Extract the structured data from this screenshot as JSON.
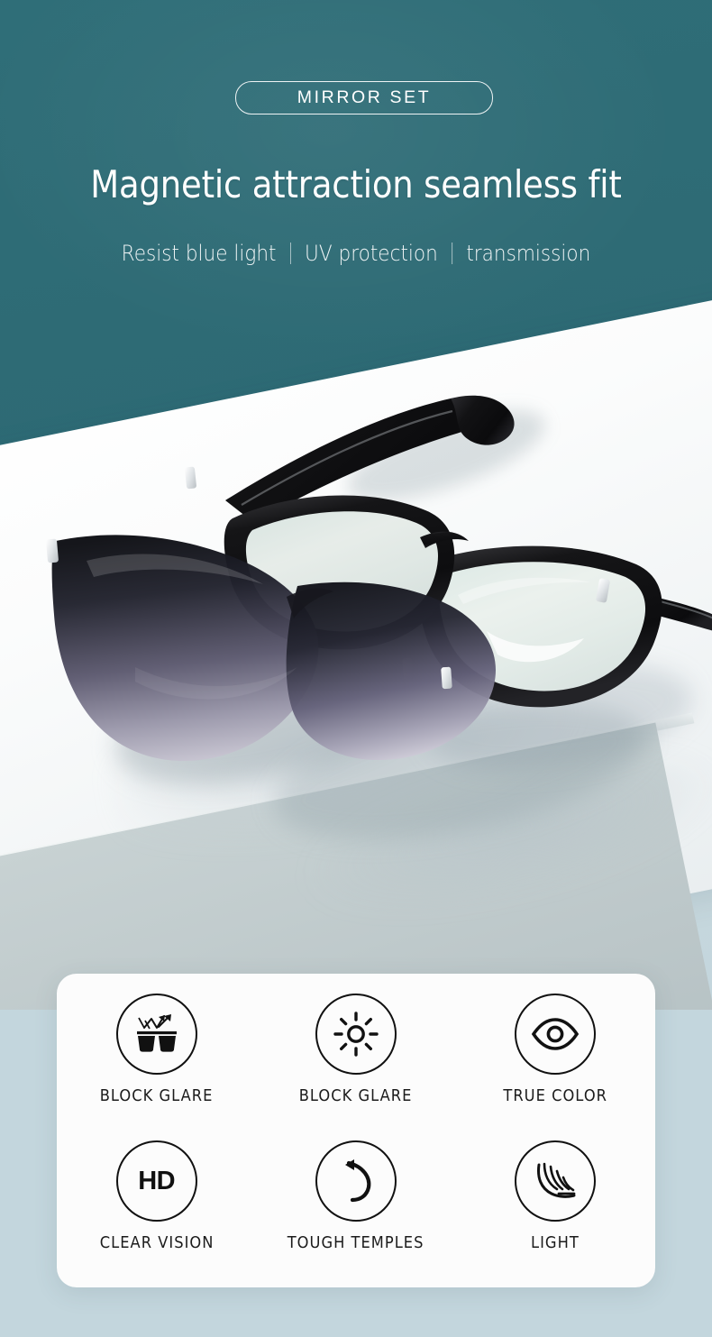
{
  "header": {
    "badge_label": "MIRROR SET",
    "title": "Magnetic attraction seamless fit",
    "subtitle_parts": [
      "Resist blue light",
      "UV protection",
      "transmission"
    ]
  },
  "colors": {
    "teal_background": "#2e6b75",
    "card_background": "#fcfcfc",
    "floor_background": "#c3d6dd",
    "pedestal_top": "#ffffff",
    "pedestal_side": "#bcc7c9",
    "icon_stroke": "#111111",
    "text_light": "#ffffff",
    "text_dark": "#1b1b1b"
  },
  "features": {
    "rows": [
      [
        {
          "icon": "sunglasses-glare-icon",
          "label": "BLOCK GLARE"
        },
        {
          "icon": "sun-brightness-icon",
          "label": "BLOCK GLARE"
        },
        {
          "icon": "eye-icon",
          "label": "TRUE COLOR"
        }
      ],
      [
        {
          "icon": "hd-badge-icon",
          "label": "CLEAR VISION",
          "text": "HD"
        },
        {
          "icon": "rotate-arrow-icon",
          "label": "TOUGH TEMPLES"
        },
        {
          "icon": "feather-icon",
          "label": "LIGHT"
        }
      ]
    ]
  },
  "product": {
    "frame_color": "#101012",
    "lens_tint": "#eef6f2",
    "clip_lens_top": "#14151c",
    "clip_lens_bottom": "#b9b6c6",
    "magnet_clip_color": "#eceff1"
  }
}
